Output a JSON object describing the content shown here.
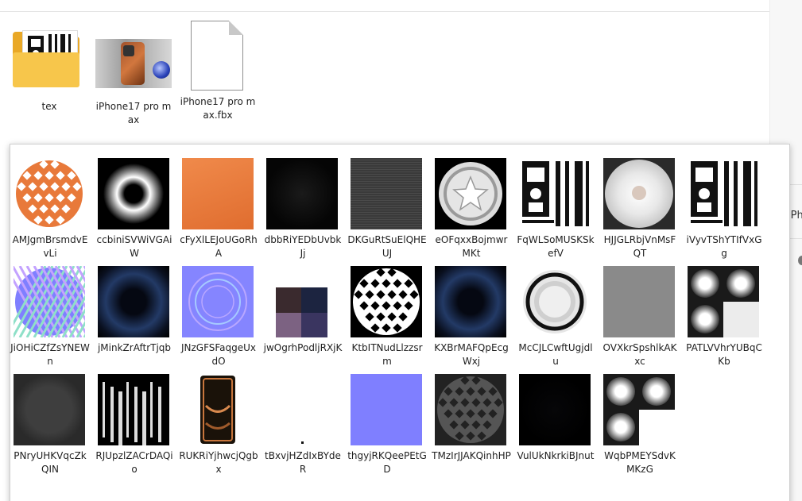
{
  "folder_items": [
    {
      "label": "tex",
      "icon": "folder-icon"
    },
    {
      "label": "iPhone17 pro max",
      "icon": "c4d-file-thumbnail"
    },
    {
      "label": "iPhone17 pro max.fbx",
      "icon": "blank-file-icon"
    }
  ],
  "right_peek": {
    "text": "iPh"
  },
  "textures": [
    {
      "name": "AMJgmBrsmdvEvLi",
      "kind": "orange-lattice"
    },
    {
      "name": "ccbiniSVWiVGAiW",
      "kind": "white-ring"
    },
    {
      "name": "cFyXlLEJoUGoRhA",
      "kind": "orange-gradient"
    },
    {
      "name": "dbbRiYEDbUvbkJj",
      "kind": "black-soft"
    },
    {
      "name": "DKGuRtSuElQHEUJ",
      "kind": "gray-lines"
    },
    {
      "name": "eOFqxxBojmwrMKt",
      "kind": "star-disc"
    },
    {
      "name": "FqWLSoMUSKSkefV",
      "kind": "bw-uv"
    },
    {
      "name": "HJJGLRbjVnMsFQT",
      "kind": "light-disc"
    },
    {
      "name": "iVyvTShYTIfVxGg",
      "kind": "bw-uv"
    },
    {
      "name": "JiOHiCZfZsYNEWn",
      "kind": "normal-lattice"
    },
    {
      "name": "jMinkZrAftrTjqb",
      "kind": "dark-blue-glow"
    },
    {
      "name": "JNzGFSFaqgeUxdO",
      "kind": "normal-rings"
    },
    {
      "name": "jwOgrhPodljRXjK",
      "kind": "swatch-quad"
    },
    {
      "name": "KtbITNudLlzzsrm",
      "kind": "bw-lattice"
    },
    {
      "name": "KXBrMAFQpEcgWxj",
      "kind": "dark-blue-glow"
    },
    {
      "name": "McCJLCwftUgjdlu",
      "kind": "gray-rings"
    },
    {
      "name": "OVXkrSpshlkAKxc",
      "kind": "gray-noise"
    },
    {
      "name": "PATLVVhrYUBqCKb",
      "kind": "ao-blobs"
    },
    {
      "name": "PNryUHKVqcZkQIN",
      "kind": "dark-disc"
    },
    {
      "name": "RJUpzlZACrDAQio",
      "kind": "bw-stripes"
    },
    {
      "name": "RUKRiYjhwcjQgbx",
      "kind": "copper-phone"
    },
    {
      "name": "tBxvjHZdIxBYdeR",
      "kind": "tiny-dot"
    },
    {
      "name": "thgyjRKQeePEtGD",
      "kind": "flat-normal"
    },
    {
      "name": "TMzIrJJAKQinhHP",
      "kind": "dark-lattice"
    },
    {
      "name": "VulUkNkrkiBJnut",
      "kind": "near-black"
    },
    {
      "name": "WqbPMEYSdvKMKzG",
      "kind": "ao-blobs-white"
    }
  ],
  "colors": {
    "folder": "#f7c64b",
    "orange": "#e8793a",
    "normal_blue": "#7f7fff",
    "panel_border": "#cfcfcf"
  }
}
